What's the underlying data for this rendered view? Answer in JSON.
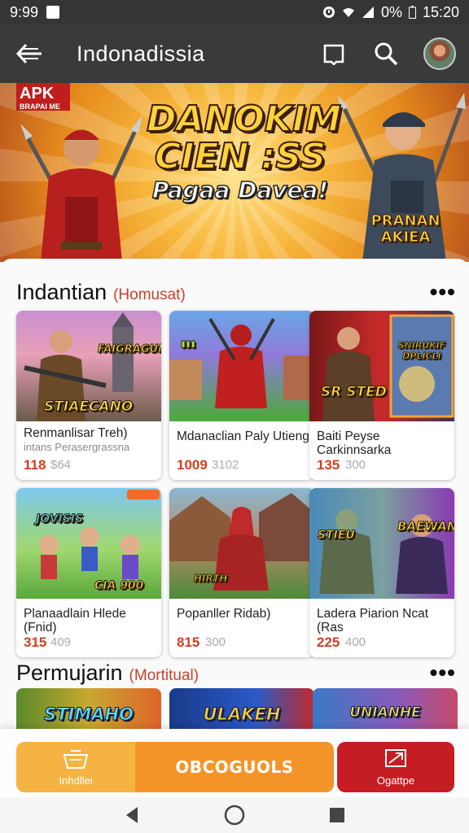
{
  "status_bar": {
    "time": "9:99",
    "battery": "0%",
    "clock": "15:20"
  },
  "app_bar": {
    "title": "Indonadissia"
  },
  "banner": {
    "brand_line1": "APK",
    "brand_line2": "BRAPAI ME",
    "headline_line1": "DANOKIM",
    "headline_line2": "CIEN :SS",
    "headline_line3": "Pagaa Davea!",
    "side_text": "PRANAN AKIEA"
  },
  "section1": {
    "title": "Indantian",
    "subtitle": "(Homusat)",
    "cards": [
      {
        "thumb_text": "STIAECANO",
        "thumb_text2": "FAIGRAGUN",
        "name": "Renmanlisar Treh)",
        "sub": "intans Perasergrassna",
        "price": "118",
        "old_price": "$64"
      },
      {
        "thumb_text": "",
        "thumb_text2": "",
        "name": "Mdanaclian Paly Utieng",
        "sub": "",
        "price": "1009",
        "old_price": "3102"
      },
      {
        "thumb_text": "SR STED",
        "thumb_text2": "SNIRUKIF DPLICLI",
        "name": "Baiti Peyse Carkinnsarka",
        "sub": "",
        "price": "135",
        "old_price": "300"
      },
      {
        "thumb_text": "CIA 900",
        "thumb_text2": "JOVISIS",
        "name": "Planaadlain Hlede (Fnid)",
        "sub": "",
        "price": "315",
        "old_price": "409"
      },
      {
        "thumb_text": "HIRTH",
        "thumb_text2": "",
        "name": "Popanller Ridab)",
        "sub": "",
        "price": "815",
        "old_price": "300"
      },
      {
        "thumb_text": "STIEU",
        "thumb_text2": "BAEWAN",
        "name": "Ladera Piarion Ncat (Ras",
        "sub": "",
        "price": "225",
        "old_price": "400"
      }
    ]
  },
  "section2": {
    "title": "Permujarin",
    "subtitle": "(Mortitual)",
    "tiles": [
      {
        "text": "STIMAHO"
      },
      {
        "text": "ULAKEH"
      },
      {
        "text": "UNIANHE"
      }
    ]
  },
  "action_bar": {
    "left_label": "Inhdllei",
    "main_label": "OBCOGUOLS",
    "right_label": "Ogattpe"
  },
  "colors": {
    "accent": "#f49428",
    "accent_light": "#f4b343",
    "danger": "#c61d24",
    "price": "#d0401e",
    "subtitle": "#c8402a"
  },
  "icons": [
    "notification-icon",
    "alarm-icon",
    "wifi-icon",
    "signal-icon",
    "battery-icon",
    "back-arrow-icon",
    "book-icon",
    "search-icon",
    "avatar",
    "more-icon",
    "basket-icon",
    "expand-icon",
    "nav-back-icon",
    "nav-home-icon",
    "nav-recents-icon"
  ]
}
